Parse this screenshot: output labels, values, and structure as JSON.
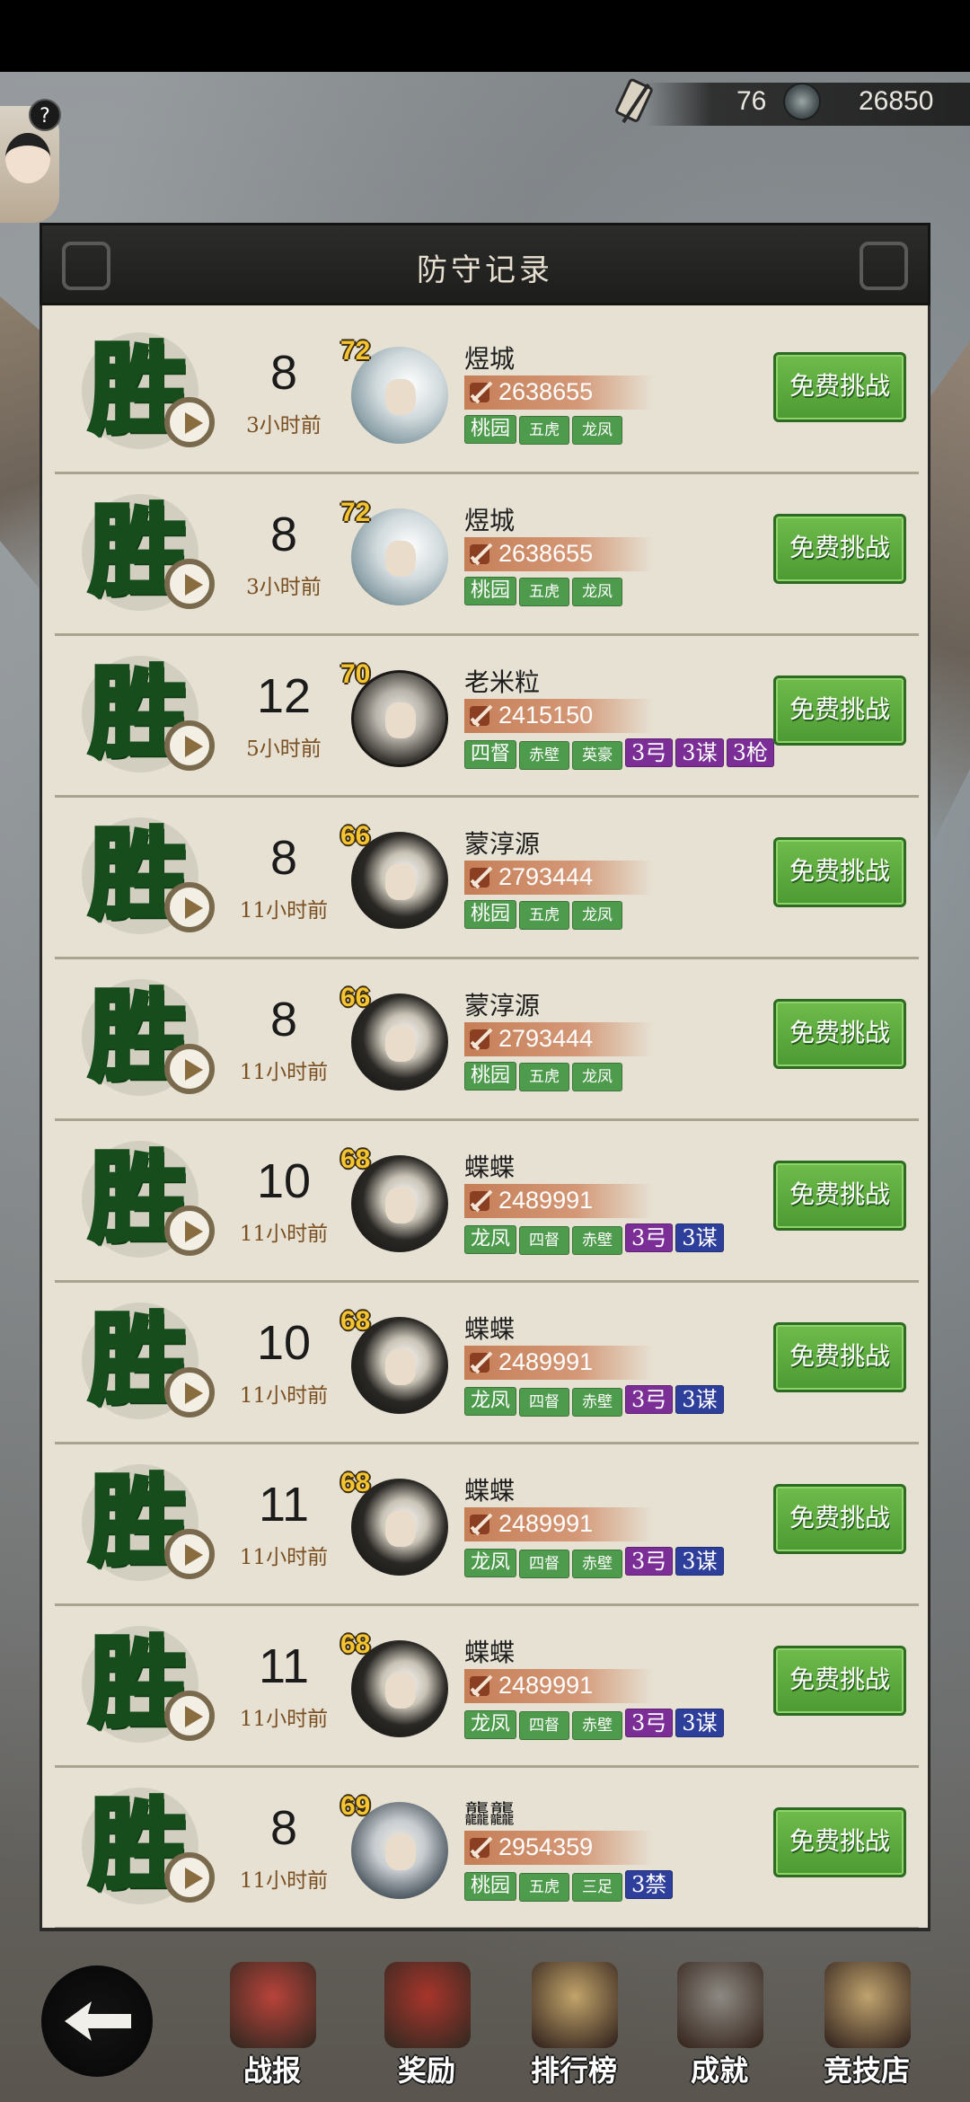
{
  "header": {
    "res_count": "76",
    "coins": "26850",
    "help": "?"
  },
  "panel": {
    "title": "防守记录"
  },
  "colors": {
    "win_green": "#59c54b",
    "challenge_green": "#4c9a33",
    "tag_green": "#4f9b4d",
    "tag_purple": "#7c2e97",
    "tag_blue": "#2d3e9b",
    "power_bar": "#c57e56"
  },
  "records": [
    {
      "result": "胜",
      "rank": "8",
      "ago": "3小时前",
      "level": "72",
      "name": "煜城",
      "power": "2638655",
      "portrait": "wispy",
      "tags": [
        {
          "t": "桃园",
          "c": "green"
        },
        {
          "t": "五虎",
          "c": "green small"
        },
        {
          "t": "龙凤",
          "c": "green small"
        }
      ],
      "button": "免费挑战"
    },
    {
      "result": "胜",
      "rank": "8",
      "ago": "3小时前",
      "level": "72",
      "name": "煜城",
      "power": "2638655",
      "portrait": "wispy",
      "tags": [
        {
          "t": "桃园",
          "c": "green"
        },
        {
          "t": "五虎",
          "c": "green small"
        },
        {
          "t": "龙凤",
          "c": "green small"
        }
      ],
      "button": "免费挑战"
    },
    {
      "result": "胜",
      "rank": "12",
      "ago": "5小时前",
      "level": "70",
      "name": "老米粒",
      "power": "2415150",
      "portrait": "elder",
      "tags": [
        {
          "t": "四督",
          "c": "green"
        },
        {
          "t": "赤壁",
          "c": "green small"
        },
        {
          "t": "英豪",
          "c": "green small"
        },
        {
          "t": "3弓",
          "c": "purple"
        },
        {
          "t": "3谋",
          "c": "purple"
        },
        {
          "t": "3枪",
          "c": "purple"
        }
      ],
      "button": "免费挑战"
    },
    {
      "result": "胜",
      "rank": "8",
      "ago": "11小时前",
      "level": "66",
      "name": "蒙淳源",
      "power": "2793444",
      "portrait": "dark",
      "tags": [
        {
          "t": "桃园",
          "c": "green"
        },
        {
          "t": "五虎",
          "c": "green small"
        },
        {
          "t": "龙凤",
          "c": "green small"
        }
      ],
      "button": "免费挑战"
    },
    {
      "result": "胜",
      "rank": "8",
      "ago": "11小时前",
      "level": "66",
      "name": "蒙淳源",
      "power": "2793444",
      "portrait": "dark",
      "tags": [
        {
          "t": "桃园",
          "c": "green"
        },
        {
          "t": "五虎",
          "c": "green small"
        },
        {
          "t": "龙凤",
          "c": "green small"
        }
      ],
      "button": "免费挑战"
    },
    {
      "result": "胜",
      "rank": "10",
      "ago": "11小时前",
      "level": "68",
      "name": "蝶蝶",
      "power": "2489991",
      "portrait": "dark",
      "tags": [
        {
          "t": "龙凤",
          "c": "green"
        },
        {
          "t": "四督",
          "c": "green small"
        },
        {
          "t": "赤壁",
          "c": "green small"
        },
        {
          "t": "3弓",
          "c": "purple"
        },
        {
          "t": "3谋",
          "c": "blue"
        }
      ],
      "button": "免费挑战"
    },
    {
      "result": "胜",
      "rank": "10",
      "ago": "11小时前",
      "level": "68",
      "name": "蝶蝶",
      "power": "2489991",
      "portrait": "dark",
      "tags": [
        {
          "t": "龙凤",
          "c": "green"
        },
        {
          "t": "四督",
          "c": "green small"
        },
        {
          "t": "赤壁",
          "c": "green small"
        },
        {
          "t": "3弓",
          "c": "purple"
        },
        {
          "t": "3谋",
          "c": "blue"
        }
      ],
      "button": "免费挑战"
    },
    {
      "result": "胜",
      "rank": "11",
      "ago": "11小时前",
      "level": "68",
      "name": "蝶蝶",
      "power": "2489991",
      "portrait": "dark",
      "tags": [
        {
          "t": "龙凤",
          "c": "green"
        },
        {
          "t": "四督",
          "c": "green small"
        },
        {
          "t": "赤壁",
          "c": "green small"
        },
        {
          "t": "3弓",
          "c": "purple"
        },
        {
          "t": "3谋",
          "c": "blue"
        }
      ],
      "button": "免费挑战"
    },
    {
      "result": "胜",
      "rank": "11",
      "ago": "11小时前",
      "level": "68",
      "name": "蝶蝶",
      "power": "2489991",
      "portrait": "dark",
      "tags": [
        {
          "t": "龙凤",
          "c": "green"
        },
        {
          "t": "四督",
          "c": "green small"
        },
        {
          "t": "赤壁",
          "c": "green small"
        },
        {
          "t": "3弓",
          "c": "purple"
        },
        {
          "t": "3谋",
          "c": "blue"
        }
      ],
      "button": "免费挑战"
    },
    {
      "result": "胜",
      "rank": "8",
      "ago": "11小时前",
      "level": "69",
      "name": "龘龘",
      "power": "2954359",
      "portrait": "swordsman",
      "tags": [
        {
          "t": "桃园",
          "c": "green"
        },
        {
          "t": "五虎",
          "c": "green small"
        },
        {
          "t": "三足",
          "c": "green small"
        },
        {
          "t": "3禁",
          "c": "blue"
        }
      ],
      "button": "免费挑战"
    }
  ],
  "nav": [
    {
      "label": "战报",
      "icon": "battle-report-icon"
    },
    {
      "label": "奖励",
      "icon": "reward-chest-icon"
    },
    {
      "label": "排行榜",
      "icon": "ranking-board-icon"
    },
    {
      "label": "成就",
      "icon": "achievement-icon"
    },
    {
      "label": "竞技店",
      "icon": "arena-shop-icon"
    }
  ]
}
